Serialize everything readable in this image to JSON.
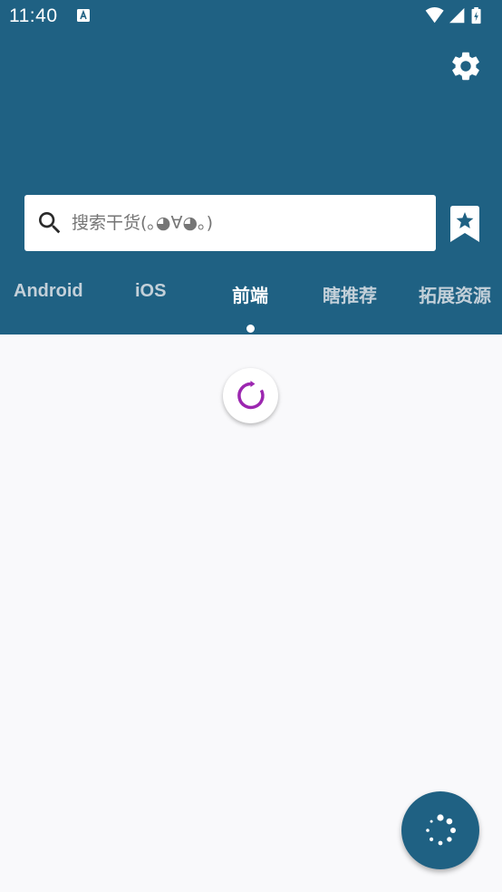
{
  "status_bar": {
    "time": "11:40",
    "icons": [
      "a-notification-icon",
      "wifi-icon",
      "signal-icon",
      "battery-charging-icon"
    ]
  },
  "header": {
    "background_color": "#1f6183",
    "settings_icon": "gear-icon"
  },
  "search": {
    "icon": "search-icon",
    "placeholder": "搜索干货(｡◕∀◕｡)",
    "value": ""
  },
  "bookmark": {
    "icon": "bookmark-star-icon"
  },
  "tabs": {
    "items": [
      {
        "label": "Android",
        "active": false
      },
      {
        "label": "iOS",
        "active": false
      },
      {
        "label": "前端",
        "active": true
      },
      {
        "label": "瞎推荐",
        "active": false
      },
      {
        "label": "拓展资源",
        "active": false
      }
    ],
    "active_color": "#ffffff",
    "inactive_color": "#c3d0d9"
  },
  "content": {
    "loading_icon": "refresh-spinner-icon",
    "spinner_color": "#9c27b0",
    "background_color": "#f9f9fb"
  },
  "fab": {
    "icon": "loading-dots-icon",
    "color": "#1f6183"
  }
}
